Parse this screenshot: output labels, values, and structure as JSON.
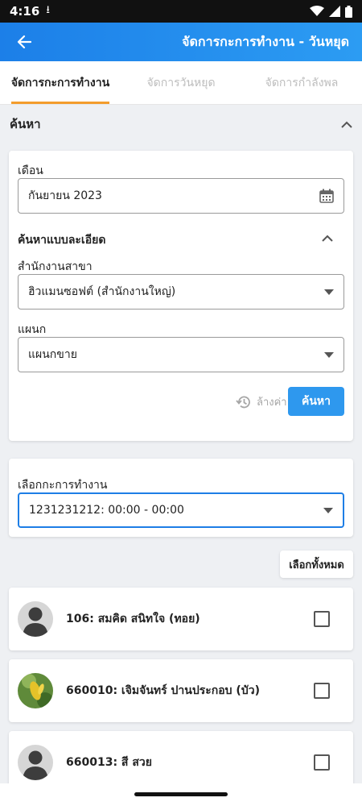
{
  "status_bar": {
    "time": "4:16"
  },
  "app_bar": {
    "title": "จัดการกะการทำงาน - วันหยุด"
  },
  "tabs": [
    {
      "label": "จัดการกะการทำงาน",
      "active": true
    },
    {
      "label": "จัดการวันหยุด",
      "active": false
    },
    {
      "label": "จัดการกำลังพล",
      "active": false
    }
  ],
  "search_section": {
    "title": "ค้นหา"
  },
  "filters": {
    "month_label": "เดือน",
    "month_value": "กันยายน 2023",
    "detail_title": "ค้นหาแบบละเอียด",
    "branch_label": "สำนักงานสาขา",
    "branch_value": "ฮิวแมนซอฟต์ (สำนักงานใหญ่)",
    "dept_label": "แผนก",
    "dept_value": "แผนกขาย",
    "clear_label": "ล้างค่า",
    "search_label": "ค้นหา"
  },
  "shift": {
    "label": "เลือกกะการทำงาน",
    "value": "1231231212: 00:00 - 00:00"
  },
  "select_all_label": "เลือกทั้งหมด",
  "employees": [
    {
      "name": "106: สมคิด สนิทใจ (ทอย)",
      "avatar": "placeholder-avatar",
      "checked": false
    },
    {
      "name": "660010: เจิมจันทร์ ปานประกอบ (บัว)",
      "avatar": "photo-avatar",
      "checked": false
    },
    {
      "name": "660013: สี สวย",
      "avatar": "placeholder-avatar",
      "checked": false
    }
  ],
  "colors": {
    "primary": "#1e7ee6",
    "accent": "#f39c2c"
  }
}
